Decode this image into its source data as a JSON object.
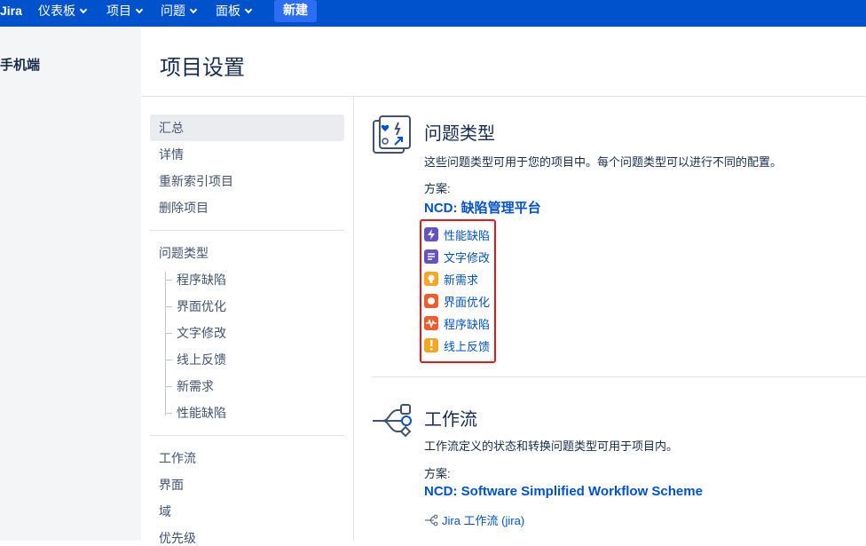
{
  "topnav": {
    "logo": "Jira",
    "items": [
      "仪表板",
      "项目",
      "问题",
      "面板"
    ],
    "create": "新建"
  },
  "project": {
    "name": "手机端"
  },
  "page": {
    "title": "项目设置"
  },
  "sidebar": {
    "group1": [
      "汇总",
      "详情",
      "重新索引项目",
      "删除项目"
    ],
    "issue_types_heading": "问题类型",
    "issue_types": [
      "程序缺陷",
      "界面优化",
      "文字修改",
      "线上反馈",
      "新需求",
      "性能缺陷"
    ],
    "group3": [
      "工作流",
      "界面",
      "域",
      "优先级"
    ]
  },
  "issue_types_section": {
    "title": "问题类型",
    "desc": "这些问题类型可用于您的项目中。每个问题类型可以进行不同的配置。",
    "scheme_label": "方案:",
    "scheme_name": "NCD: 缺陷管理平台",
    "items": [
      {
        "name": "性能缺陷",
        "color": "#6554c0"
      },
      {
        "name": "文字修改",
        "color": "#6554c0"
      },
      {
        "name": "新需求",
        "color": "#f5a623"
      },
      {
        "name": "界面优化",
        "color": "#f15c2c"
      },
      {
        "name": "程序缺陷",
        "color": "#f15c2c"
      },
      {
        "name": "线上反馈",
        "color": "#f5a623"
      }
    ]
  },
  "workflow_section": {
    "title": "工作流",
    "desc": "工作流定义的状态和转换问题类型可用于项目内。",
    "scheme_label": "方案:",
    "scheme_name": "NCD: Software Simplified Workflow Scheme",
    "link": "Jira 工作流 (jira)"
  }
}
